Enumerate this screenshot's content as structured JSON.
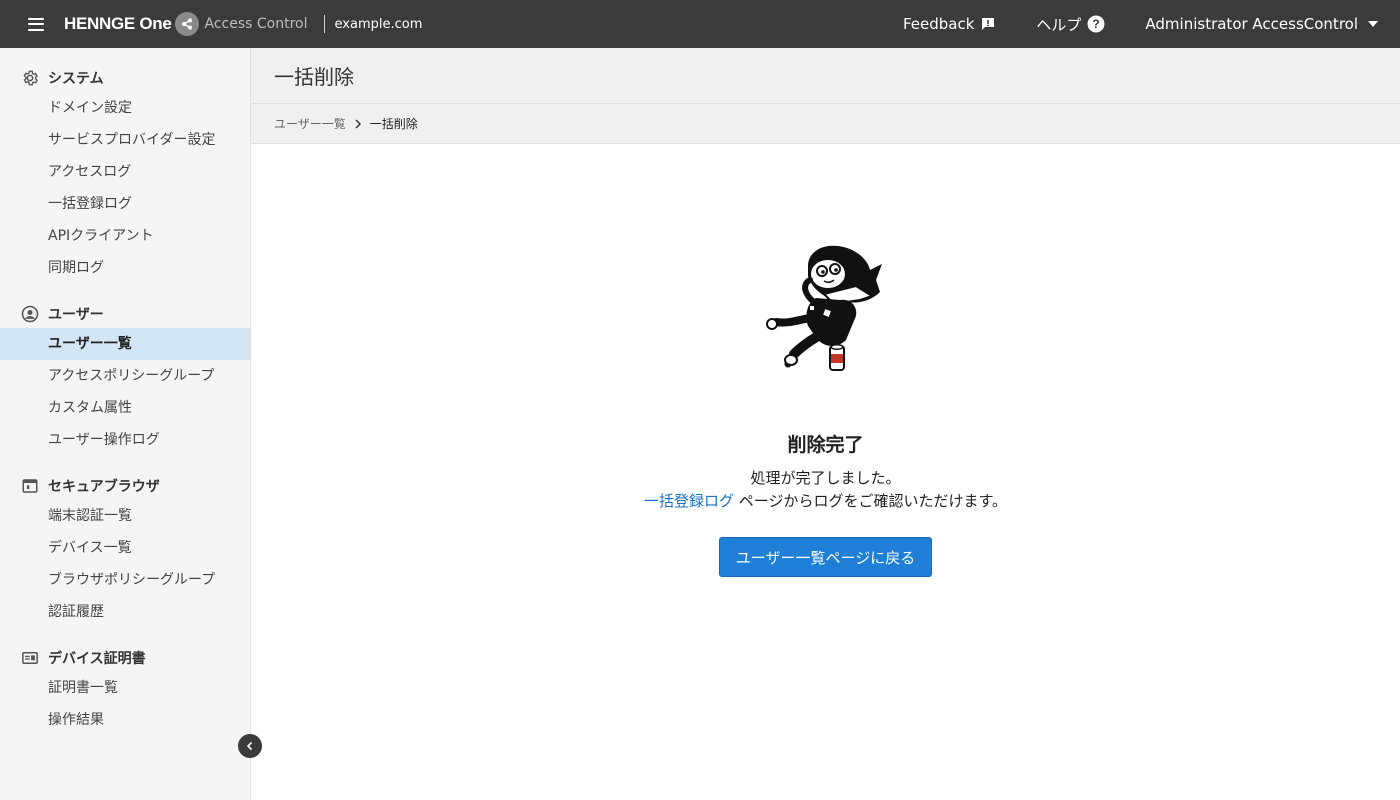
{
  "topbar": {
    "brand": "HENNGE One",
    "product": "Access Control",
    "tenant": "example.com",
    "feedback_label": "Feedback",
    "help_label": "ヘルプ",
    "user_label": "Administrator AccessControl"
  },
  "sidebar": {
    "sections": [
      {
        "title": "システム",
        "icon": "gear-icon",
        "items": [
          "ドメイン設定",
          "サービスプロバイダー設定",
          "アクセスログ",
          "一括登録ログ",
          "APIクライアント",
          "同期ログ"
        ]
      },
      {
        "title": "ユーザー",
        "icon": "user-circle-icon",
        "items": [
          "ユーザー一覧",
          "アクセスポリシーグループ",
          "カスタム属性",
          "ユーザー操作ログ"
        ]
      },
      {
        "title": "セキュアブラウザ",
        "icon": "browser-icon",
        "items": [
          "端末認証一覧",
          "デバイス一覧",
          "ブラウザポリシーグループ",
          "認証履歴"
        ]
      },
      {
        "title": "デバイス証明書",
        "icon": "certificate-icon",
        "items": [
          "証明書一覧",
          "操作結果"
        ]
      }
    ],
    "active_item": "ユーザー一覧"
  },
  "main": {
    "page_title": "一括削除",
    "breadcrumb": {
      "parent": "ユーザー一覧",
      "current": "一括削除"
    },
    "result": {
      "title": "削除完了",
      "message_line1": "処理が完了しました。",
      "link_text": "一括登録ログ",
      "message_line2_suffix": " ページからログをご確認いただけます。",
      "button_label": "ユーザー一覧ページに戻る"
    }
  },
  "colors": {
    "topbar_bg": "#3b3b3b",
    "sidebar_bg": "#f5f5f5",
    "active_item_bg": "#d3e6f8",
    "primary_button": "#1f7fd6",
    "link": "#1a73c6"
  }
}
